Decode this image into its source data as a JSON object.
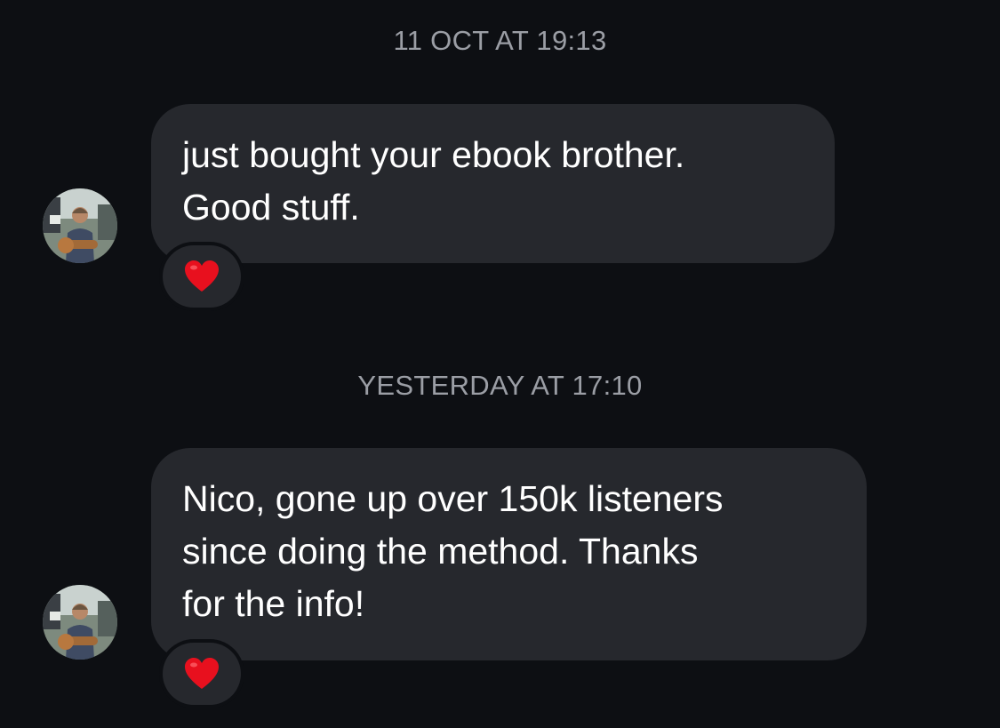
{
  "conversation": {
    "messages": [
      {
        "timestamp": "11 OCT AT 19:13",
        "text": "just bought your ebook brother.\nGood stuff.",
        "reaction": "heart-icon"
      },
      {
        "timestamp": "YESTERDAY AT 17:10",
        "text": "Nico, gone up over 150k listeners\nsince doing the method. Thanks\nfor the info!",
        "reaction": "heart-icon"
      }
    ]
  },
  "colors": {
    "background": "#0d0f13",
    "bubble": "#26282d",
    "timestamp": "#9b9ea5",
    "text": "#ffffff",
    "heart": "#e8101e"
  }
}
